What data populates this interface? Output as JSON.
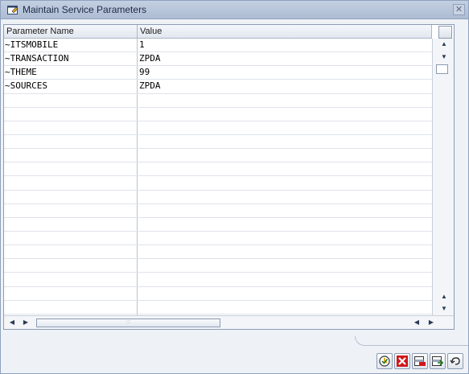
{
  "window": {
    "title": "Maintain Service Parameters",
    "close_glyph": "✕"
  },
  "table": {
    "columns": [
      "Parameter Name",
      "Value"
    ],
    "rows": [
      {
        "name": "~ITSMOBILE",
        "value": "1"
      },
      {
        "name": "~TRANSACTION",
        "value": "ZPDA"
      },
      {
        "name": "~THEME",
        "value": "99"
      },
      {
        "name": "~SOURCES",
        "value": "ZPDA"
      },
      {
        "name": "",
        "value": ""
      },
      {
        "name": "",
        "value": ""
      },
      {
        "name": "",
        "value": ""
      },
      {
        "name": "",
        "value": ""
      },
      {
        "name": "",
        "value": ""
      },
      {
        "name": "",
        "value": ""
      },
      {
        "name": "",
        "value": ""
      },
      {
        "name": "",
        "value": ""
      },
      {
        "name": "",
        "value": ""
      },
      {
        "name": "",
        "value": ""
      },
      {
        "name": "",
        "value": ""
      },
      {
        "name": "",
        "value": ""
      },
      {
        "name": "",
        "value": ""
      },
      {
        "name": "",
        "value": ""
      },
      {
        "name": "",
        "value": ""
      },
      {
        "name": "",
        "value": ""
      },
      {
        "name": "",
        "value": ""
      }
    ]
  },
  "toolbar": {
    "buttons": [
      "check-icon",
      "cancel-icon",
      "delete-row-icon",
      "insert-row-icon",
      "undo-icon"
    ]
  },
  "colors": {
    "accent": "#aebcd3",
    "cancel": "#d0181a",
    "check": "#e2a400"
  }
}
